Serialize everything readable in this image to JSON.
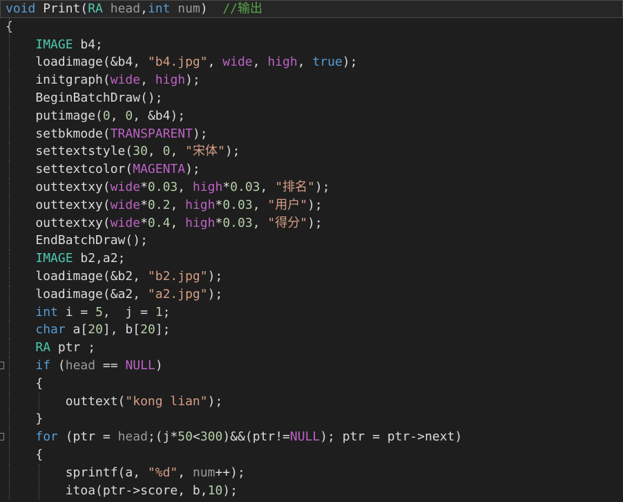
{
  "editor": {
    "lines": [
      [
        {
          "t": "void",
          "c": "kw"
        },
        {
          "t": " Print(",
          "c": "id"
        },
        {
          "t": "RA",
          "c": "ty"
        },
        {
          "t": " head",
          "c": "par"
        },
        {
          "t": ",",
          "c": "id"
        },
        {
          "t": "int",
          "c": "kw"
        },
        {
          "t": " num",
          "c": "par"
        },
        {
          "t": ")  ",
          "c": "id"
        },
        {
          "t": "//输出",
          "c": "cmt"
        }
      ],
      [
        {
          "t": "{",
          "c": "id"
        }
      ],
      [
        {
          "t": "    ",
          "c": "id"
        },
        {
          "t": "IMAGE",
          "c": "ty"
        },
        {
          "t": " b4;",
          "c": "id"
        }
      ],
      [
        {
          "t": "    loadimage(&b4, ",
          "c": "id"
        },
        {
          "t": "\"b4.jpg\"",
          "c": "str"
        },
        {
          "t": ", ",
          "c": "id"
        },
        {
          "t": "wide",
          "c": "mac"
        },
        {
          "t": ", ",
          "c": "id"
        },
        {
          "t": "high",
          "c": "mac"
        },
        {
          "t": ", ",
          "c": "id"
        },
        {
          "t": "true",
          "c": "kw"
        },
        {
          "t": ");",
          "c": "id"
        }
      ],
      [
        {
          "t": "    initgraph(",
          "c": "id"
        },
        {
          "t": "wide",
          "c": "mac"
        },
        {
          "t": ", ",
          "c": "id"
        },
        {
          "t": "high",
          "c": "mac"
        },
        {
          "t": ");",
          "c": "id"
        }
      ],
      [
        {
          "t": "    BeginBatchDraw();",
          "c": "id"
        }
      ],
      [
        {
          "t": "    putimage(",
          "c": "id"
        },
        {
          "t": "0",
          "c": "num"
        },
        {
          "t": ", ",
          "c": "id"
        },
        {
          "t": "0",
          "c": "num"
        },
        {
          "t": ", &b4);",
          "c": "id"
        }
      ],
      [
        {
          "t": "    setbkmode(",
          "c": "id"
        },
        {
          "t": "TRANSPARENT",
          "c": "mac"
        },
        {
          "t": ");",
          "c": "id"
        }
      ],
      [
        {
          "t": "    settextstyle(",
          "c": "id"
        },
        {
          "t": "30",
          "c": "num"
        },
        {
          "t": ", ",
          "c": "id"
        },
        {
          "t": "0",
          "c": "num"
        },
        {
          "t": ", ",
          "c": "id"
        },
        {
          "t": "\"宋体\"",
          "c": "str"
        },
        {
          "t": ");",
          "c": "id"
        }
      ],
      [
        {
          "t": "    settextcolor(",
          "c": "id"
        },
        {
          "t": "MAGENTA",
          "c": "mac"
        },
        {
          "t": ");",
          "c": "id"
        }
      ],
      [
        {
          "t": "    outtextxy(",
          "c": "id"
        },
        {
          "t": "wide",
          "c": "mac"
        },
        {
          "t": "*",
          "c": "id"
        },
        {
          "t": "0.03",
          "c": "num"
        },
        {
          "t": ", ",
          "c": "id"
        },
        {
          "t": "high",
          "c": "mac"
        },
        {
          "t": "*",
          "c": "id"
        },
        {
          "t": "0.03",
          "c": "num"
        },
        {
          "t": ", ",
          "c": "id"
        },
        {
          "t": "\"排名\"",
          "c": "str"
        },
        {
          "t": ");",
          "c": "id"
        }
      ],
      [
        {
          "t": "    outtextxy(",
          "c": "id"
        },
        {
          "t": "wide",
          "c": "mac"
        },
        {
          "t": "*",
          "c": "id"
        },
        {
          "t": "0.2",
          "c": "num"
        },
        {
          "t": ", ",
          "c": "id"
        },
        {
          "t": "high",
          "c": "mac"
        },
        {
          "t": "*",
          "c": "id"
        },
        {
          "t": "0.03",
          "c": "num"
        },
        {
          "t": ", ",
          "c": "id"
        },
        {
          "t": "\"用户\"",
          "c": "str"
        },
        {
          "t": ");",
          "c": "id"
        }
      ],
      [
        {
          "t": "    outtextxy(",
          "c": "id"
        },
        {
          "t": "wide",
          "c": "mac"
        },
        {
          "t": "*",
          "c": "id"
        },
        {
          "t": "0.4",
          "c": "num"
        },
        {
          "t": ", ",
          "c": "id"
        },
        {
          "t": "high",
          "c": "mac"
        },
        {
          "t": "*",
          "c": "id"
        },
        {
          "t": "0.03",
          "c": "num"
        },
        {
          "t": ", ",
          "c": "id"
        },
        {
          "t": "\"得分\"",
          "c": "str"
        },
        {
          "t": ");",
          "c": "id"
        }
      ],
      [
        {
          "t": "    EndBatchDraw();",
          "c": "id"
        }
      ],
      [
        {
          "t": "    ",
          "c": "id"
        },
        {
          "t": "IMAGE",
          "c": "ty"
        },
        {
          "t": " b2,a2;",
          "c": "id"
        }
      ],
      [
        {
          "t": "    loadimage(&b2, ",
          "c": "id"
        },
        {
          "t": "\"b2.jpg\"",
          "c": "str"
        },
        {
          "t": ");",
          "c": "id"
        }
      ],
      [
        {
          "t": "    loadimage(&a2, ",
          "c": "id"
        },
        {
          "t": "\"a2.jpg\"",
          "c": "str"
        },
        {
          "t": ");",
          "c": "id"
        }
      ],
      [
        {
          "t": "    ",
          "c": "id"
        },
        {
          "t": "int",
          "c": "kw"
        },
        {
          "t": " i = ",
          "c": "id"
        },
        {
          "t": "5",
          "c": "num"
        },
        {
          "t": ",  j = ",
          "c": "id"
        },
        {
          "t": "1",
          "c": "num"
        },
        {
          "t": ";",
          "c": "id"
        }
      ],
      [
        {
          "t": "    ",
          "c": "id"
        },
        {
          "t": "char",
          "c": "kw"
        },
        {
          "t": " a[",
          "c": "id"
        },
        {
          "t": "20",
          "c": "num"
        },
        {
          "t": "], b[",
          "c": "id"
        },
        {
          "t": "20",
          "c": "num"
        },
        {
          "t": "];",
          "c": "id"
        }
      ],
      [
        {
          "t": "    ",
          "c": "id"
        },
        {
          "t": "RA",
          "c": "ty"
        },
        {
          "t": " ptr ;",
          "c": "id"
        }
      ],
      [
        {
          "t": "    ",
          "c": "id"
        },
        {
          "t": "if",
          "c": "kw"
        },
        {
          "t": " (",
          "c": "id"
        },
        {
          "t": "head",
          "c": "par"
        },
        {
          "t": " == ",
          "c": "id"
        },
        {
          "t": "NULL",
          "c": "mac"
        },
        {
          "t": ")",
          "c": "id"
        }
      ],
      [
        {
          "t": "    {",
          "c": "id"
        }
      ],
      [
        {
          "t": "        outtext(",
          "c": "id"
        },
        {
          "t": "\"kong lian\"",
          "c": "str"
        },
        {
          "t": ");",
          "c": "id"
        }
      ],
      [
        {
          "t": "    }",
          "c": "id"
        }
      ],
      [
        {
          "t": "    ",
          "c": "id"
        },
        {
          "t": "for",
          "c": "kw"
        },
        {
          "t": " (ptr = ",
          "c": "id"
        },
        {
          "t": "head",
          "c": "par"
        },
        {
          "t": ";(j*",
          "c": "id"
        },
        {
          "t": "50",
          "c": "num"
        },
        {
          "t": "<",
          "c": "id"
        },
        {
          "t": "300",
          "c": "num"
        },
        {
          "t": ")&&(ptr!=",
          "c": "id"
        },
        {
          "t": "NULL",
          "c": "mac"
        },
        {
          "t": "); ptr = ptr->next)",
          "c": "id"
        }
      ],
      [
        {
          "t": "    {",
          "c": "id"
        }
      ],
      [
        {
          "t": "        sprintf(a, ",
          "c": "id"
        },
        {
          "t": "\"%d\"",
          "c": "str"
        },
        {
          "t": ", ",
          "c": "id"
        },
        {
          "t": "num",
          "c": "par"
        },
        {
          "t": "++);",
          "c": "id"
        }
      ],
      [
        {
          "t": "        itoa(ptr->score, b,",
          "c": "id"
        },
        {
          "t": "10",
          "c": "num"
        },
        {
          "t": ");",
          "c": "id"
        }
      ]
    ],
    "fold_lines": [
      0,
      20,
      24
    ],
    "guides": [
      {
        "col": 0,
        "from": 1,
        "to": 27
      },
      {
        "col": 4,
        "from": 22,
        "to": 22
      },
      {
        "col": 4,
        "from": 26,
        "to": 27
      }
    ],
    "colors": {
      "background": "#1e1e1e",
      "keyword": "#569cd6",
      "type": "#4ec9b0",
      "macro": "#bd63c5",
      "string": "#d69d85",
      "number": "#b5cea8",
      "comment": "#57a64a",
      "parameter": "#9a9a9a",
      "identifier": "#dcdcdc"
    }
  }
}
